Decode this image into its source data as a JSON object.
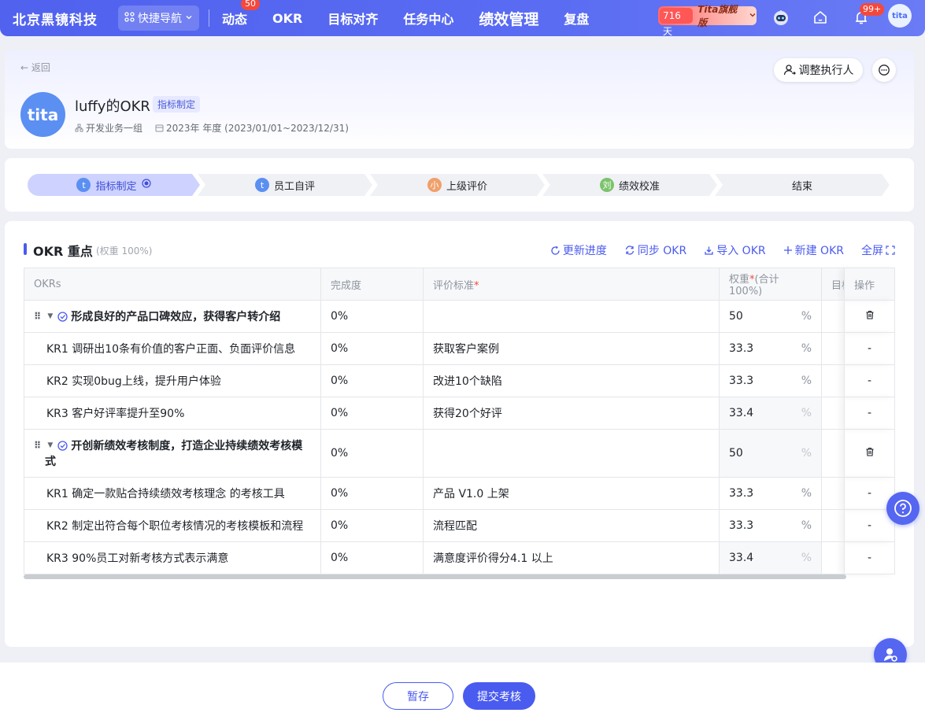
{
  "topnav": {
    "brand": "北京黑镜科技",
    "quick_nav": "快捷导航",
    "items": [
      {
        "label": "动态",
        "badge": "50"
      },
      {
        "label": "OKR"
      },
      {
        "label": "目标对齐"
      },
      {
        "label": "任务中心"
      },
      {
        "label": "绩效管理"
      },
      {
        "label": "复盘"
      }
    ],
    "edition_days": "716天",
    "edition_name": "Tita旗舰版",
    "bell_badge": "99+",
    "avatar_text": "tita"
  },
  "header": {
    "back": "返回",
    "title": "luffy的OKR",
    "tag": "指标制定",
    "department": "开发业务一组",
    "period": "2023年 年度 (2023/01/01~2023/12/31)",
    "adjust_button": "调整执行人",
    "avatar_text": "tita"
  },
  "steps": [
    {
      "label": "指标制定",
      "icon_text": "",
      "icon_color": "#5b8ff2"
    },
    {
      "label": "员工自评",
      "icon_text": "",
      "icon_color": "#5b8ff2"
    },
    {
      "label": "上级评价",
      "icon_text": "小",
      "icon_color": "#f0a06a"
    },
    {
      "label": "绩效校准",
      "icon_text": "刘",
      "icon_color": "#7cc36c"
    },
    {
      "label": "结束",
      "icon_text": "",
      "icon_color": ""
    }
  ],
  "okr_section": {
    "title": "OKR 重点",
    "weight_note": "(权重 100%)",
    "actions": {
      "update": "更新进度",
      "sync": "同步 OKR",
      "import": "导入 OKR",
      "create": "新建 OKR",
      "fullscreen": "全屏"
    },
    "columns": {
      "okrs": "OKRs",
      "completion": "完成度",
      "criteria": "评价标准",
      "weight": "权重",
      "weight_note": "(合计100%)",
      "target": "目标",
      "ops": "操作"
    },
    "rows": {
      "o1": {
        "name": "形成良好的产品口碑效应，获得客户转介绍",
        "completion": "0%",
        "criteria": "",
        "weight": "50",
        "unit": "%"
      },
      "o1kr1": {
        "name": "KR1 调研出10条有价值的客户正面、负面评价信息",
        "completion": "0%",
        "criteria": "获取客户案例",
        "weight": "33.3",
        "unit": "%",
        "op": "-"
      },
      "o1kr2": {
        "name": "KR2 实现0bug上线，提升用户体验",
        "completion": "0%",
        "criteria": "改进10个缺陷",
        "weight": "33.3",
        "unit": "%",
        "op": "-"
      },
      "o1kr3": {
        "name": "KR3 客户好评率提升至90%",
        "completion": "0%",
        "criteria": "获得20个好评",
        "weight": "33.4",
        "unit": "%",
        "op": "-"
      },
      "o2": {
        "name_line1": "开创新绩效考核制度，打造企业持续绩效考核模",
        "name_line2": "式",
        "completion": "0%",
        "criteria": "",
        "weight": "50",
        "unit": "%"
      },
      "o2kr1": {
        "name": "KR1 确定一款贴合持续绩效考核理念 的考核工具",
        "completion": "0%",
        "criteria": "产品 V1.0 上架",
        "weight": "33.3",
        "unit": "%",
        "op": "-"
      },
      "o2kr2": {
        "name": "KR2 制定出符合每个职位考核情况的考核模板和流程",
        "completion": "0%",
        "criteria": "流程匹配",
        "weight": "33.3",
        "unit": "%",
        "op": "-"
      },
      "o2kr3": {
        "name": "KR3 90%员工对新考核方式表示满意",
        "completion": "0%",
        "criteria": "满意度评价得分4.1 以上",
        "weight": "33.4",
        "unit": "%",
        "op": "-"
      }
    }
  },
  "footer": {
    "save": "暂存",
    "submit": "提交考核"
  },
  "colors": {
    "primary": "#4a5bef",
    "nav_gradient_start": "#5062ee",
    "badge_red": "#f5483b"
  }
}
